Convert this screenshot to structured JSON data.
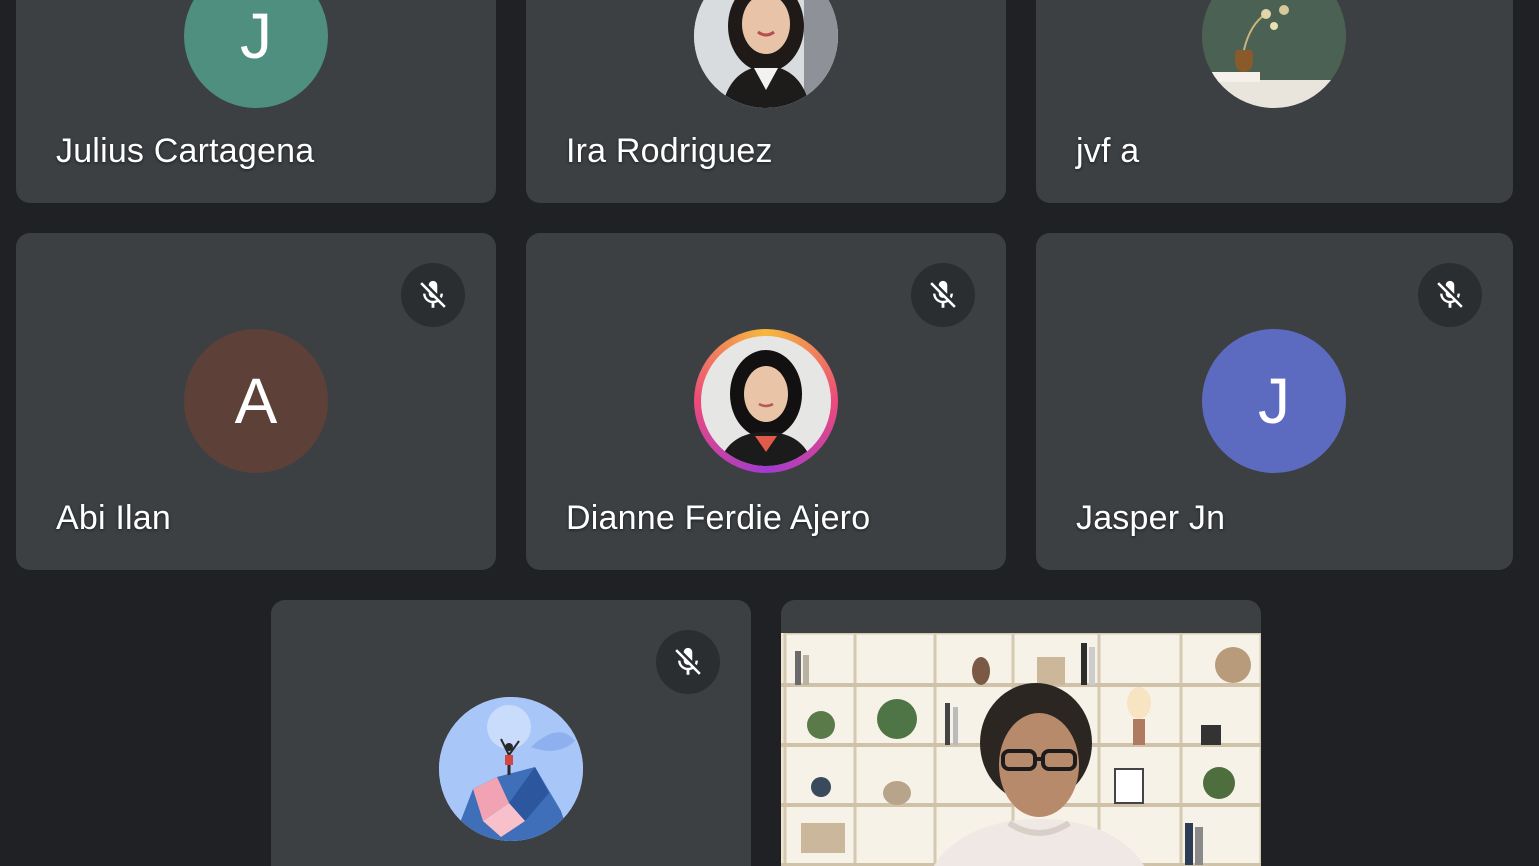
{
  "participants": [
    {
      "name": "Julius Cartagena",
      "initial": "J",
      "avatar_color": "#4f8f7f"
    },
    {
      "name": "Ira Rodriguez"
    },
    {
      "name": "jvf a"
    },
    {
      "name": "Abi Ilan",
      "initial": "A",
      "avatar_color": "#5d4037",
      "muted": true
    },
    {
      "name": "Dianne Ferdie Ajero",
      "muted": true
    },
    {
      "name": "Jasper Jn",
      "initial": "J",
      "avatar_color": "#5c6bc0",
      "muted": true
    },
    {
      "name": "",
      "muted": true
    },
    {
      "name": "",
      "video": true
    }
  ],
  "colors": {
    "background": "#202124",
    "tile": "#3c4043",
    "mic_badge": "#2b2e31"
  }
}
